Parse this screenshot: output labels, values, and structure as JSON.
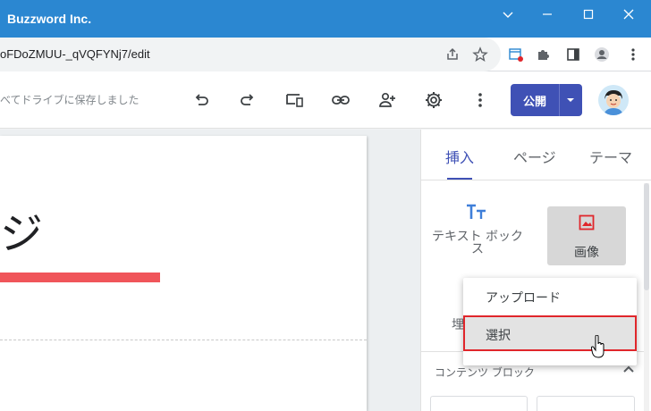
{
  "window": {
    "title": "Buzzword Inc."
  },
  "address": {
    "url": "oFDoZMUU-_qVQFYNj7/edit"
  },
  "toolbar": {
    "saved_status": "べてドライブに保存しました",
    "publish_label": "公開"
  },
  "page": {
    "title": "ジ"
  },
  "panel": {
    "tabs": [
      {
        "label": "挿入"
      },
      {
        "label": "ページ"
      },
      {
        "label": "テーマ"
      }
    ],
    "tools": {
      "text_box_label": "テキスト ボックス",
      "image_label": "画像",
      "embed_partial": "埋"
    },
    "image_menu": [
      {
        "label": "アップロード"
      },
      {
        "label": "選択"
      }
    ],
    "content_blocks_label": "コンテンツ ブロック"
  },
  "colors": {
    "titlebar": "#2b87d1",
    "accent": "#3f51b5",
    "highlight": "#e0262b",
    "red_bar": "#f0555a"
  }
}
